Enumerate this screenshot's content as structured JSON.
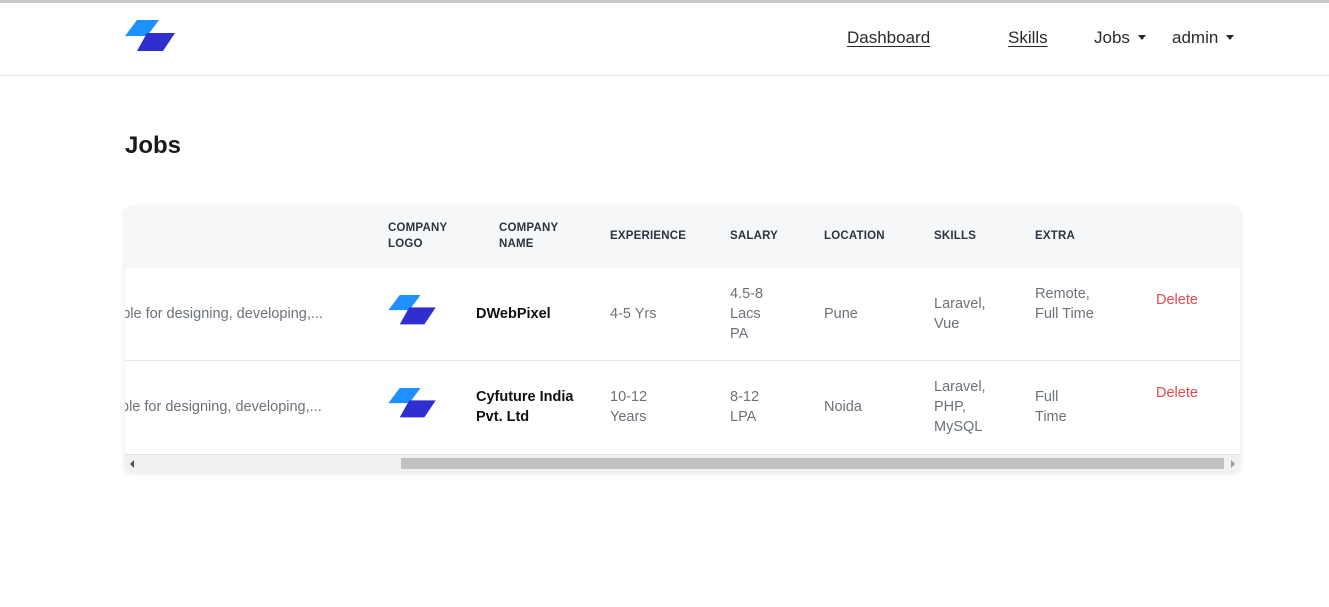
{
  "nav": {
    "logo_icon": "brand-parallelogram-logo",
    "links": [
      "Dashboard",
      "Skills"
    ],
    "dropdowns": [
      "Jobs",
      "admin"
    ]
  },
  "page": {
    "title": "Jobs"
  },
  "table": {
    "headers": {
      "company_logo": "COMPANY LOGO",
      "company_name": "COMPANY NAME",
      "experience": "EXPERIENCE",
      "salary": "SALARY",
      "location": "LOCATION",
      "skills": "SKILLS",
      "extra": "EXTRA"
    },
    "rows": [
      {
        "description": "ible for designing, developing,...",
        "company_name": "DWebPixel",
        "experience": "4-5 Yrs",
        "salary": "4.5-8 Lacs PA",
        "location": "Pune",
        "skills": "Laravel, Vue",
        "extra": "Remote, Full Time",
        "action": "Delete"
      },
      {
        "description": "ble for designing, developing,...",
        "company_name": "Cyfuture India Pvt. Ltd",
        "experience": "10-12 Years",
        "salary": "8-12 LPA",
        "location": "Noida",
        "skills": "Laravel, PHP, MySQL",
        "extra": "Full Time",
        "action": "Delete"
      }
    ]
  },
  "colors": {
    "brand_light": "#1e90ff",
    "brand_dark": "#2f2fd0",
    "delete": "#e5484d"
  }
}
